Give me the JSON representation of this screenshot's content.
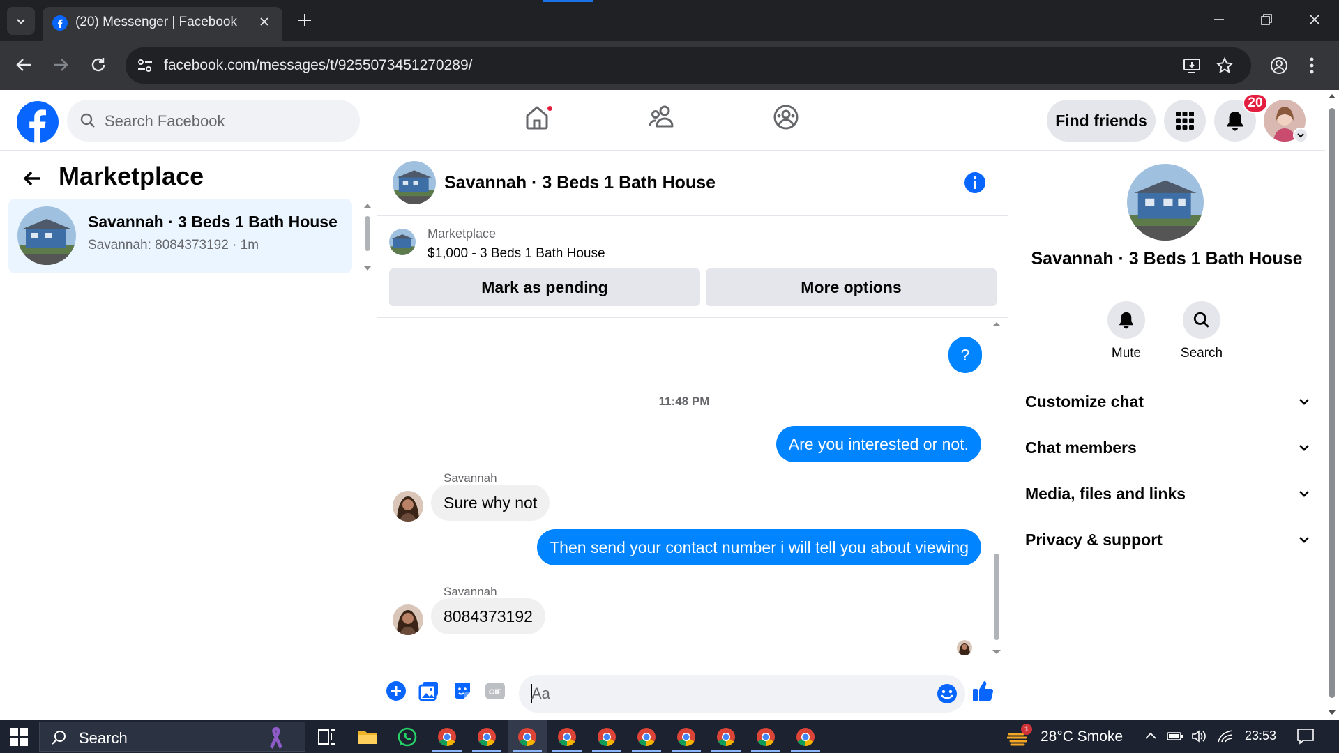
{
  "browser": {
    "tab_title": "(20) Messenger | Facebook",
    "url": "facebook.com/messages/t/9255073451270289/"
  },
  "fb_nav": {
    "search_placeholder": "Search Facebook",
    "find_friends": "Find friends",
    "notification_count": "20"
  },
  "left_panel": {
    "title": "Marketplace",
    "conversation": {
      "name": "Savannah · 3 Beds 1 Bath House",
      "preview": "Savannah: 8084373192 · 1m"
    }
  },
  "chat": {
    "header_name": "Savannah · 3 Beds 1 Bath House",
    "listing_label": "Marketplace",
    "listing_price": "$1,000 - 3 Beds 1 Bath House",
    "mark_pending": "Mark as pending",
    "more_options": "More options",
    "messages": {
      "first_out": "?",
      "timestamp": "11:48 PM",
      "out1": "Are you interested or not.",
      "sender1": "Savannah",
      "in1": "Sure why not",
      "out2": "Then send your contact number i will tell you about viewing",
      "sender2": "Savannah",
      "in2": "8084373192"
    },
    "input_placeholder": "Aa"
  },
  "right_panel": {
    "name": "Savannah · 3 Beds 1 Bath House",
    "mute_label": "Mute",
    "search_label": "Search",
    "sections": [
      "Customize chat",
      "Chat members",
      "Media, files and links",
      "Privacy & support"
    ]
  },
  "taskbar": {
    "search_placeholder": "Search",
    "weather": "28°C  Smoke",
    "weather_badge": "1",
    "time": "23:53"
  },
  "colors": {
    "fb_blue": "#0866ff",
    "messenger_blue": "#0084ff",
    "notification_red": "#e41e3f",
    "selected_bg": "#ebf5ff"
  }
}
